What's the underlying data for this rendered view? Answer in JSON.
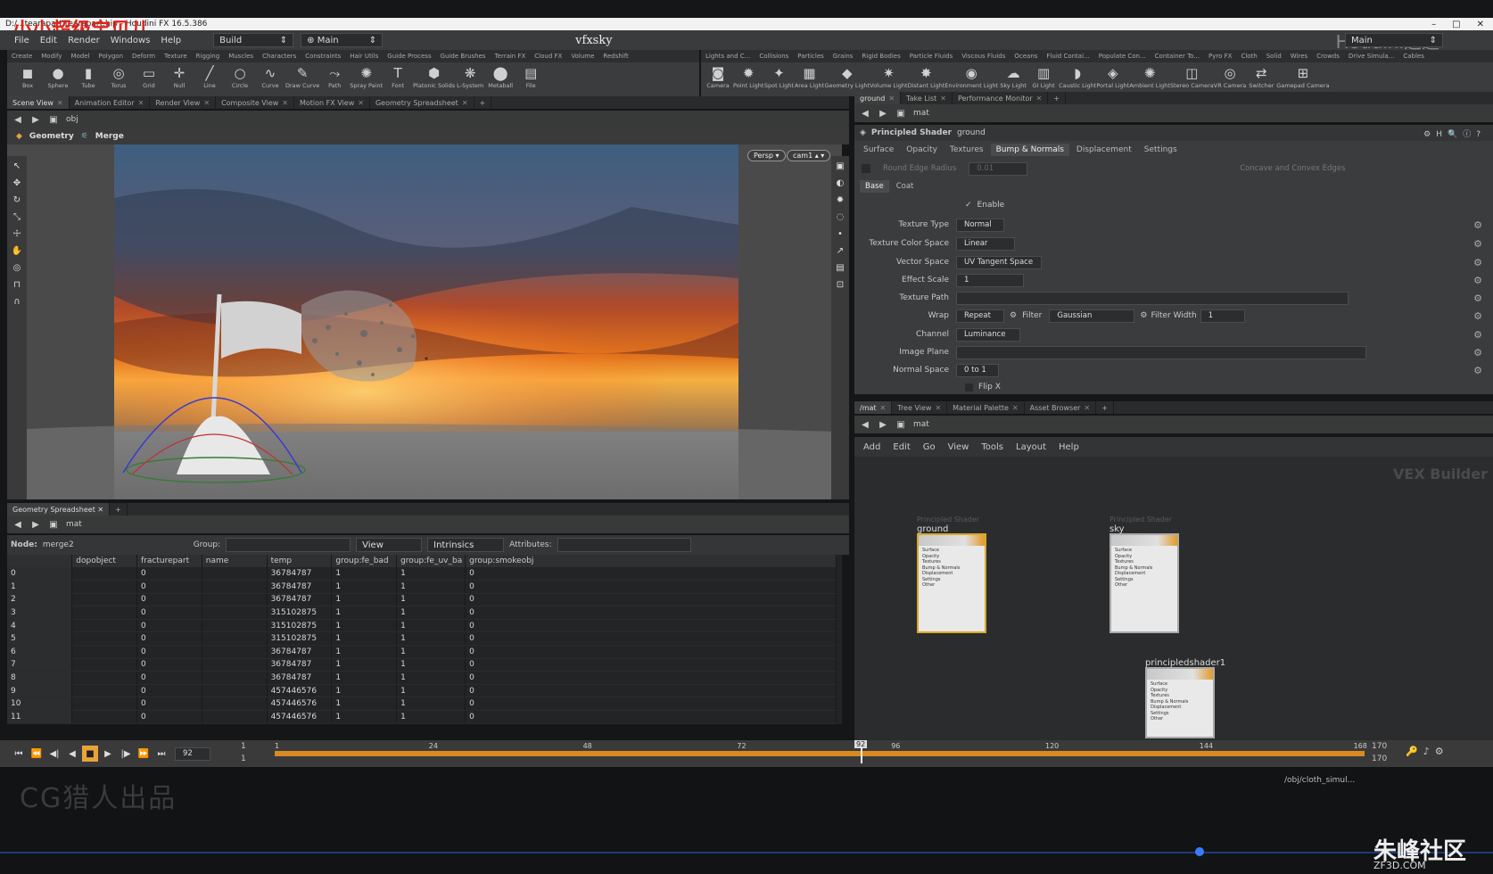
{
  "window": {
    "title": "D:/...tearapart/tearapart.hip - Houdini FX 16.5.386",
    "min": "–",
    "max": "□",
    "close": "✕"
  },
  "watermarks": {
    "top_left": "小小超级宝贝儿",
    "bottom_left": "CG猎人出品",
    "bottom_right": "朱峰社区",
    "bottom_right_url": "ZF3D.COM",
    "top_right": "Houdini之道",
    "vex_builder": "VEX Builder"
  },
  "menubar": {
    "items": [
      "File",
      "Edit",
      "Render",
      "Windows",
      "Help"
    ],
    "desk": "Build",
    "desk2": "Main",
    "center_title": "vfxsky",
    "right_desk": "Main"
  },
  "shelf_tabs_left": [
    "Create",
    "Modify",
    "Model",
    "Polygon",
    "Deform",
    "Texture",
    "Rigging",
    "Muscles",
    "Characters",
    "Constraints",
    "Hair Utils",
    "Guide Process",
    "Guide Brushes",
    "Terrain FX",
    "Cloud FX",
    "Volume",
    "Redshift"
  ],
  "shelf_tabs_right": [
    "Lights and C...",
    "Collisions",
    "Particles",
    "Grains",
    "Rigid Bodies",
    "Particle Fluids",
    "Viscous Fluids",
    "Oceans",
    "Fluid Contai...",
    "Populate Con...",
    "Container To...",
    "Pyro FX",
    "Cloth",
    "Solid",
    "Wires",
    "Crowds",
    "Drive Simula...",
    "Cables"
  ],
  "shelf_tools_left": [
    {
      "label": "Box",
      "icon": "box-icon",
      "g": "◼"
    },
    {
      "label": "Sphere",
      "icon": "sphere-icon",
      "g": "●"
    },
    {
      "label": "Tube",
      "icon": "tube-icon",
      "g": "▮"
    },
    {
      "label": "Torus",
      "icon": "torus-icon",
      "g": "◎"
    },
    {
      "label": "Grid",
      "icon": "grid-icon",
      "g": "▭"
    },
    {
      "label": "Null",
      "icon": "null-icon",
      "g": "✛"
    },
    {
      "label": "Line",
      "icon": "line-icon",
      "g": "╱"
    },
    {
      "label": "Circle",
      "icon": "circle-icon",
      "g": "○"
    },
    {
      "label": "Curve",
      "icon": "curve-icon",
      "g": "∿"
    },
    {
      "label": "Draw Curve",
      "icon": "draw-curve-icon",
      "g": "✎"
    },
    {
      "label": "Path",
      "icon": "path-icon",
      "g": "⤳"
    },
    {
      "label": "Spray Paint",
      "icon": "spray-paint-icon",
      "g": "✺"
    },
    {
      "label": "Font",
      "icon": "font-icon",
      "g": "T"
    },
    {
      "label": "Platonic Solids",
      "icon": "platonic-solids-icon",
      "g": "⬢"
    },
    {
      "label": "L-System",
      "icon": "l-system-icon",
      "g": "❋"
    },
    {
      "label": "Metaball",
      "icon": "metaball-icon",
      "g": "⬤"
    },
    {
      "label": "File",
      "icon": "file-icon",
      "g": "▤"
    }
  ],
  "shelf_tools_right": [
    {
      "label": "Camera",
      "icon": "camera-icon",
      "g": "◙"
    },
    {
      "label": "Point Light",
      "icon": "point-light-icon",
      "g": "✹"
    },
    {
      "label": "Spot Light",
      "icon": "spot-light-icon",
      "g": "✦"
    },
    {
      "label": "Area Light",
      "icon": "area-light-icon",
      "g": "▦"
    },
    {
      "label": "Geometry Light",
      "icon": "geometry-light-icon",
      "g": "◆"
    },
    {
      "label": "Volume Light",
      "icon": "volume-light-icon",
      "g": "✷"
    },
    {
      "label": "Distant Light",
      "icon": "distant-light-icon",
      "g": "✸"
    },
    {
      "label": "Environment Light",
      "icon": "environment-light-icon",
      "g": "◉"
    },
    {
      "label": "Sky Light",
      "icon": "sky-light-icon",
      "g": "☁"
    },
    {
      "label": "GI Light",
      "icon": "gi-light-icon",
      "g": "▥"
    },
    {
      "label": "Caustic Light",
      "icon": "caustic-light-icon",
      "g": "◗"
    },
    {
      "label": "Portal Light",
      "icon": "portal-light-icon",
      "g": "◈"
    },
    {
      "label": "Ambient Light",
      "icon": "ambient-light-icon",
      "g": "✺"
    },
    {
      "label": "Stereo Camera",
      "icon": "stereo-camera-icon",
      "g": "◫"
    },
    {
      "label": "VR Camera",
      "icon": "vr-camera-icon",
      "g": "◎"
    },
    {
      "label": "Switcher",
      "icon": "switcher-icon",
      "g": "⇄"
    },
    {
      "label": "Gamepad Camera",
      "icon": "gamepad-camera-icon",
      "g": "⊞"
    }
  ],
  "left_tabs": [
    "Scene View",
    "Animation Editor",
    "Render View",
    "Composite View",
    "Motion FX View",
    "Geometry Spreadsheet"
  ],
  "left_path": "obj",
  "viewer": {
    "net": "Geometry",
    "node": "Merge",
    "persp": "Persp ▾",
    "cam": "cam1 ▴ ▾"
  },
  "sheet": {
    "tab": "Geometry Spreadsheet",
    "path": "mat",
    "node_label": "Node:",
    "node": "merge2",
    "group_label": "Group:",
    "view": "View",
    "intrinsics": "Intrinsics",
    "attributes_label": "Attributes:",
    "columns": [
      "",
      "dopobject",
      "fracturepart",
      "name",
      "temp",
      "group:fe_bad",
      "group:fe_uv_ba",
      "group:smokeobj"
    ],
    "rows": [
      [
        "0",
        "",
        "0",
        "",
        "36784787",
        "1",
        "1",
        "0"
      ],
      [
        "1",
        "",
        "0",
        "",
        "36784787",
        "1",
        "1",
        "0"
      ],
      [
        "2",
        "",
        "0",
        "",
        "36784787",
        "1",
        "1",
        "0"
      ],
      [
        "3",
        "",
        "0",
        "",
        "315102875",
        "1",
        "1",
        "0"
      ],
      [
        "4",
        "",
        "0",
        "",
        "315102875",
        "1",
        "1",
        "0"
      ],
      [
        "5",
        "",
        "0",
        "",
        "315102875",
        "1",
        "1",
        "0"
      ],
      [
        "6",
        "",
        "0",
        "",
        "36784787",
        "1",
        "1",
        "0"
      ],
      [
        "7",
        "",
        "0",
        "",
        "36784787",
        "1",
        "1",
        "0"
      ],
      [
        "8",
        "",
        "0",
        "",
        "36784787",
        "1",
        "1",
        "0"
      ],
      [
        "9",
        "",
        "0",
        "",
        "457446576",
        "1",
        "1",
        "0"
      ],
      [
        "10",
        "",
        "0",
        "",
        "457446576",
        "1",
        "1",
        "0"
      ],
      [
        "11",
        "",
        "0",
        "",
        "457446576",
        "1",
        "1",
        "0"
      ]
    ]
  },
  "right_tabs": [
    "ground",
    "Take List",
    "Performance Monitor"
  ],
  "right_path": "mat",
  "shader": {
    "type": "Principled Shader",
    "name": "ground",
    "tabs": [
      "Surface",
      "Opacity",
      "Textures",
      "Bump & Normals",
      "Displacement",
      "Settings"
    ],
    "active_tab": "Bump & Normals",
    "round_edge": "Round Edge Radius",
    "round_val": "0.01",
    "concave": "Concave and Convex Edges",
    "subtabs": [
      "Base",
      "Coat"
    ],
    "enable": "Enable",
    "params": [
      {
        "label": "Texture Type",
        "value": "Normal"
      },
      {
        "label": "Texture Color Space",
        "value": "Linear"
      },
      {
        "label": "Vector Space",
        "value": "UV Tangent Space"
      },
      {
        "label": "Effect Scale",
        "value": "1"
      },
      {
        "label": "Texture Path",
        "value": ""
      },
      {
        "label": "Wrap",
        "value": "Repeat"
      },
      {
        "label": "Channel",
        "value": "Luminance"
      },
      {
        "label": "Image Plane",
        "value": ""
      },
      {
        "label": "Normal Space",
        "value": "0 to 1"
      }
    ],
    "filter_label": "Filter",
    "filter": "Gaussian",
    "filter_width_label": "Filter Width",
    "filter_width": "1",
    "flipx": "Flip X"
  },
  "net_tabs": [
    "/mat",
    "Tree View",
    "Material Palette",
    "Asset Browser"
  ],
  "net_path": "mat",
  "net_menu": [
    "Add",
    "Edit",
    "Go",
    "View",
    "Tools",
    "Layout",
    "Help"
  ],
  "nodes": [
    {
      "type": "Principled Shader",
      "name": "ground"
    },
    {
      "type": "Principled Shader",
      "name": "sky"
    },
    {
      "type": "",
      "name": "principledshader1"
    }
  ],
  "node_inputs": [
    "Surface",
    "Opacity",
    "Textures",
    "Bump & Normals",
    "Displacement",
    "Settings",
    "Other"
  ],
  "timeline": {
    "current": "92",
    "start": "1",
    "start2": "1",
    "end": "170",
    "end2": "170",
    "ticks": [
      "1",
      "24",
      "48",
      "72",
      "96",
      "120",
      "144",
      "168"
    ],
    "marker": "92"
  },
  "statusbar": {
    "path": "/obj/cloth_simul..."
  }
}
